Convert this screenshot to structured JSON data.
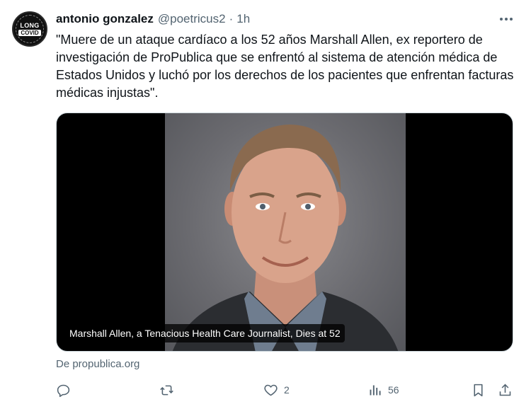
{
  "tweet": {
    "author": {
      "name": "antonio gonzalez",
      "handle": "@poetricus2",
      "avatar_text_line1": "LONG",
      "avatar_text_line2": "COVID"
    },
    "separator": "·",
    "time": "1h",
    "text": "\"Muere de un ataque cardíaco a los 52 años Marshall Allen, ex reportero de investigación de ProPublica que se enfrentó al sistema de atención médica de Estados Unidos y luchó por los derechos de los pacientes que enfrentan facturas médicas injustas\".",
    "card": {
      "caption": "Marshall Allen, a Tenacious Health Care Journalist, Dies at 52"
    },
    "source": "De propublica.org",
    "actions": {
      "reply_icon": "reply-icon",
      "retweet_icon": "retweet-icon",
      "like_icon": "heart-icon",
      "like_count": "2",
      "views_icon": "views-icon",
      "views_count": "56",
      "bookmark_icon": "bookmark-icon",
      "share_icon": "share-icon"
    }
  }
}
